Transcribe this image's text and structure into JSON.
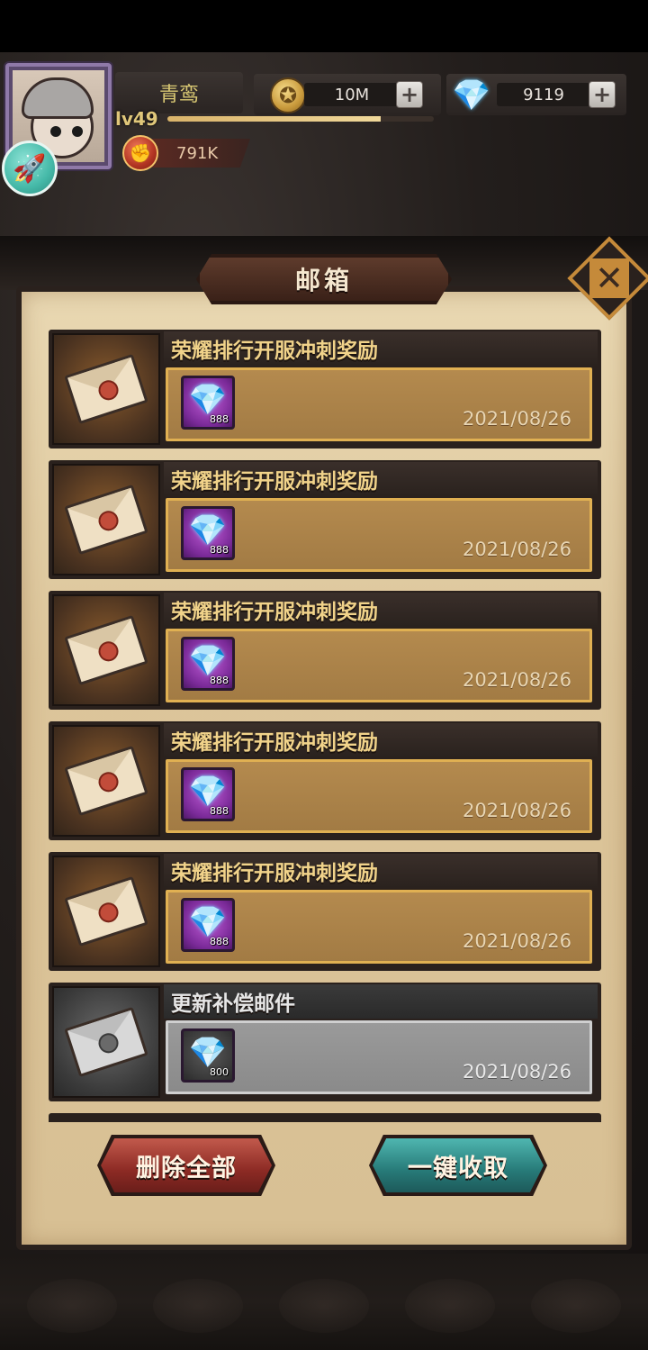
{
  "player": {
    "name": "青鸾",
    "level": "lv49",
    "exp_fraction": 0.8,
    "power": "791K"
  },
  "resources": {
    "coins": "10M",
    "gems": "9119"
  },
  "icons": {
    "coin": "coin-icon",
    "gem": "gem-icon",
    "power": "fist-icon",
    "rocket": "rocket-icon",
    "close": "close-icon",
    "mail": "envelope-icon"
  },
  "mailbox": {
    "title": "邮箱",
    "mails": [
      {
        "title": "荣耀排行开服冲刺奖励",
        "reward_qty": "888",
        "date": "2021/08/26",
        "read": false
      },
      {
        "title": "荣耀排行开服冲刺奖励",
        "reward_qty": "888",
        "date": "2021/08/26",
        "read": false
      },
      {
        "title": "荣耀排行开服冲刺奖励",
        "reward_qty": "888",
        "date": "2021/08/26",
        "read": false
      },
      {
        "title": "荣耀排行开服冲刺奖励",
        "reward_qty": "888",
        "date": "2021/08/26",
        "read": false
      },
      {
        "title": "荣耀排行开服冲刺奖励",
        "reward_qty": "888",
        "date": "2021/08/26",
        "read": false
      },
      {
        "title": "更新补偿邮件",
        "reward_qty": "800",
        "date": "2021/08/26",
        "read": true
      }
    ],
    "delete_all_label": "删除全部",
    "collect_all_label": "一键收取"
  },
  "colors": {
    "accent_gold": "#e0b052",
    "delete_red": "#8c2a24",
    "collect_teal": "#277a78"
  }
}
